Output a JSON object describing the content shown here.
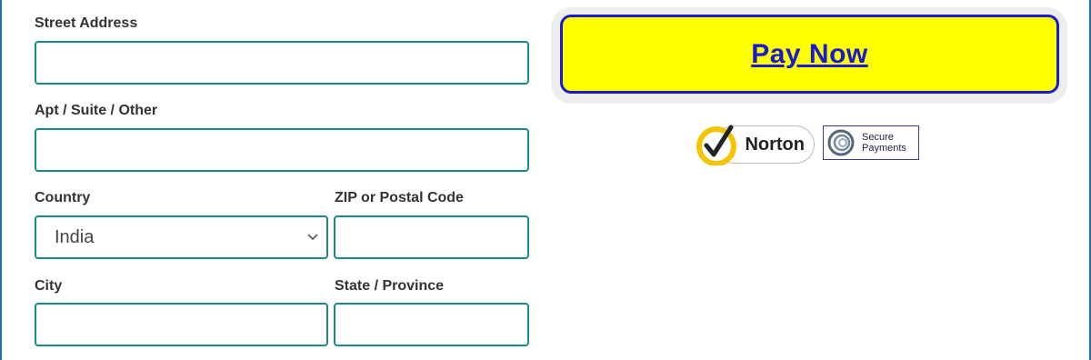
{
  "form": {
    "street_address": {
      "label": "Street Address",
      "value": ""
    },
    "apt_suite": {
      "label": "Apt / Suite / Other",
      "value": ""
    },
    "country": {
      "label": "Country",
      "selected": "India"
    },
    "zip": {
      "label": "ZIP or Postal Code",
      "value": ""
    },
    "city": {
      "label": "City",
      "value": ""
    },
    "state": {
      "label": "State / Province",
      "value": ""
    }
  },
  "payment": {
    "pay_label": "Pay Now",
    "button_color": "#ffff00",
    "button_border_color": "#1a1ad0"
  },
  "badges": {
    "norton": {
      "text": "Norton",
      "icon": "norton-check-icon"
    },
    "secure_payments": {
      "line1": "Secure",
      "line2": "Payments",
      "icon": "secure-payments-icon"
    }
  },
  "colors": {
    "field_border": "#1a8a8a",
    "frame_border": "#1f6fb5"
  }
}
